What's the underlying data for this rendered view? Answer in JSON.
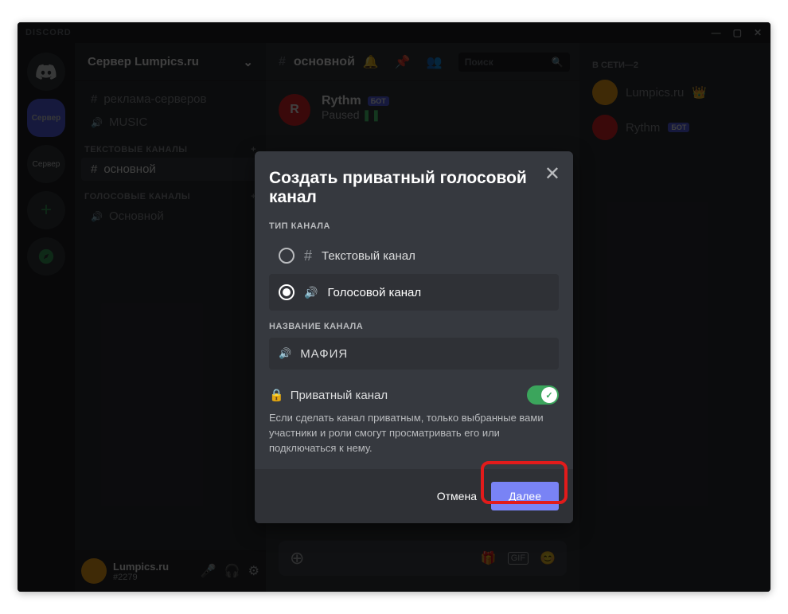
{
  "titlebar": {
    "app_name": "DISCORD"
  },
  "server_header": {
    "name": "Сервер Lumpics.ru"
  },
  "channels": {
    "misc": [
      {
        "kind": "hash",
        "label": "реклама-серверов"
      },
      {
        "kind": "speaker",
        "label": "MUSIC"
      }
    ],
    "text_section": "ТЕКСТОВЫЕ КАНАЛЫ",
    "text_items": [
      {
        "label": "основной",
        "active": true
      }
    ],
    "voice_section": "ГОЛОСОВЫЕ КАНАЛЫ",
    "voice_items": [
      {
        "label": "Основной"
      }
    ]
  },
  "user_panel": {
    "name": "Lumpics.ru",
    "discr": "#2279"
  },
  "content_header": {
    "channel": "основной",
    "search_placeholder": "Поиск"
  },
  "bot_message": {
    "name": "Rythm",
    "tag": "БОТ",
    "status": "Paused"
  },
  "members": {
    "section": "В СЕТИ—2",
    "list": [
      {
        "name": "Lumpics.ru",
        "color_class": "orange",
        "badge": "👑"
      },
      {
        "name": "Rythm",
        "color_class": "red",
        "tag": "БОТ"
      }
    ]
  },
  "modal": {
    "title": "Создать приватный голосовой канал",
    "type_label": "ТИП КАНАЛА",
    "options": {
      "text": "Текстовый канал",
      "voice": "Голосовой канал"
    },
    "name_label": "НАЗВАНИЕ КАНАЛА",
    "name_value": "МАФИЯ",
    "private_label": "Приватный канал",
    "private_desc": "Если сделать канал приватным, только выбранные вами участники и роли смогут просматривать его или подключаться к нему.",
    "cancel": "Отмена",
    "next": "Далее"
  }
}
